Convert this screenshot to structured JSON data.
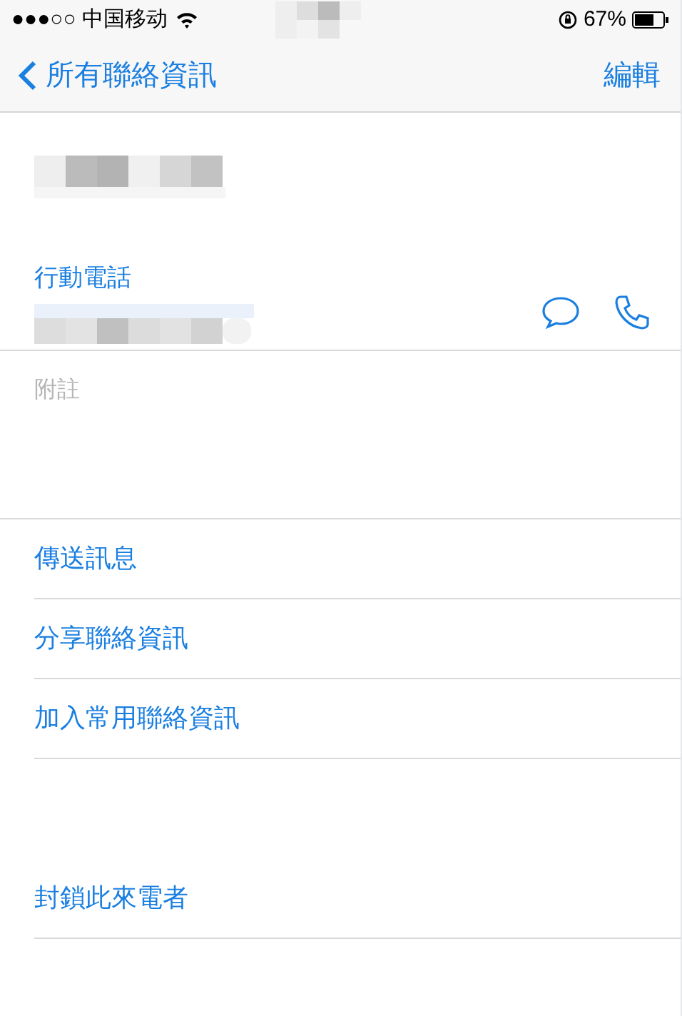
{
  "status_bar": {
    "carrier": "●●●○○ 中国移动",
    "battery": "67%"
  },
  "nav_bar": {
    "back": "所有聯絡資訊",
    "edit": "編輯"
  },
  "phone": {
    "label": "行動電話"
  },
  "notes": {
    "placeholder": "附註"
  },
  "actions": [
    {
      "label": "傳送訊息"
    },
    {
      "label": "分享聯絡資訊"
    },
    {
      "label": "加入常用聯絡資訊"
    }
  ],
  "block_action": {
    "label": "封鎖此來電者"
  }
}
